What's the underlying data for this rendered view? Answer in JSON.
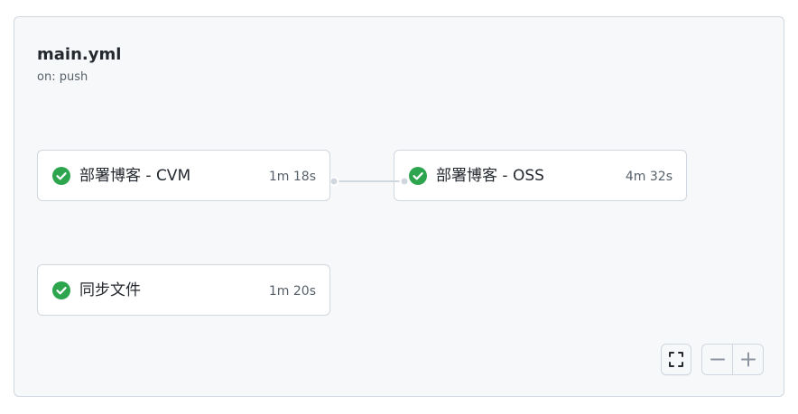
{
  "workflow": {
    "title": "main.yml",
    "trigger": "on: push"
  },
  "jobs": [
    {
      "name": "部署博客 - CVM",
      "duration": "1m 18s",
      "status": "success"
    },
    {
      "name": "部署博客 - OSS",
      "duration": "4m 32s",
      "status": "success"
    },
    {
      "name": "同步文件",
      "duration": "1m 20s",
      "status": "success"
    }
  ],
  "controls": {
    "fullscreen_icon": "fullscreen-icon",
    "zoom_out_icon": "minus-icon",
    "zoom_in_icon": "plus-icon"
  },
  "colors": {
    "success": "#2da44e",
    "panel_bg": "#f6f8fa",
    "border": "#d0d7de",
    "text": "#24292f",
    "muted": "#57606a"
  }
}
